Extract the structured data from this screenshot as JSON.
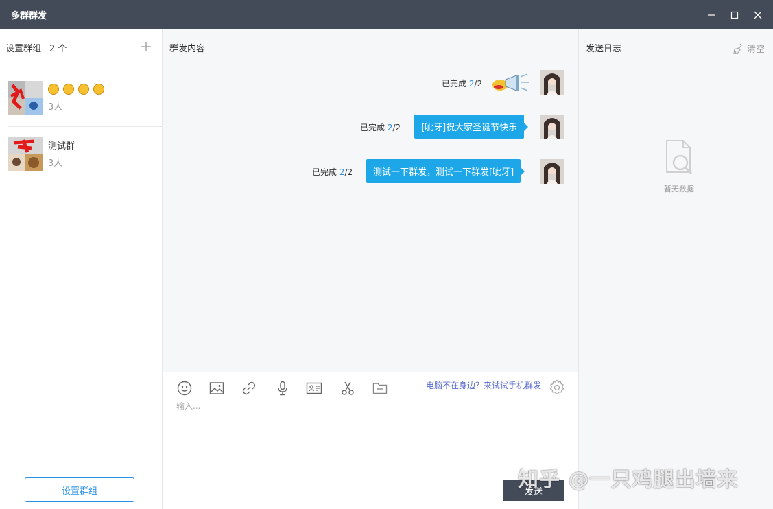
{
  "window": {
    "title": "多群群发"
  },
  "left_panel": {
    "header_label": "设置群组",
    "count": "2 个",
    "groups": [
      {
        "name": "",
        "emoji_count": 4,
        "members": "3人"
      },
      {
        "name": "测试群",
        "members": "3人"
      }
    ],
    "set_group_button": "设置群组"
  },
  "middle_panel": {
    "header_label": "群发内容",
    "messages": [
      {
        "status_prefix": "已完成",
        "done": "2",
        "total": "/2",
        "type": "sticker",
        "content": ""
      },
      {
        "status_prefix": "已完成",
        "done": "2",
        "total": "/2",
        "type": "text",
        "content": "[呲牙]祝大家圣诞节快乐"
      },
      {
        "status_prefix": "已完成",
        "done": "2",
        "total": "/2",
        "type": "text",
        "content": "测试一下群发，测试一下群发[呲牙]"
      }
    ],
    "composer": {
      "toolbar_icons": [
        "emoji-icon",
        "image-icon",
        "link-icon",
        "microphone-icon",
        "card-icon",
        "scissors-icon",
        "folder-icon"
      ],
      "phone_link": "电脑不在身边？来试试手机群发",
      "placeholder": "输入...",
      "send_button": "发送"
    }
  },
  "right_panel": {
    "header_label": "发送日志",
    "clear_label": "清空",
    "empty_text": "暂无数据"
  },
  "watermark": "知乎 @一只鸡腿出墙来",
  "colors": {
    "titlebar": "#434a58",
    "accent_blue": "#1ea7e8",
    "link_purple": "#5b6ccf",
    "panel_bg": "#f6f7f9"
  }
}
